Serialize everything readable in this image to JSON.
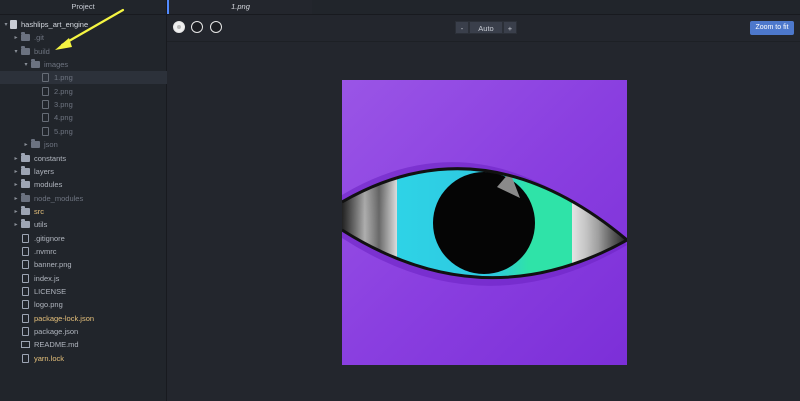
{
  "sidebar": {
    "header": "Project",
    "tree": [
      {
        "label": "hashlips_art_engine",
        "type": "repo",
        "depth": 0,
        "chevron": "down",
        "style": "root"
      },
      {
        "label": ".git",
        "type": "folder",
        "depth": 1,
        "chevron": "right",
        "style": "dim"
      },
      {
        "label": "build",
        "type": "folder",
        "depth": 1,
        "chevron": "down",
        "style": "dim"
      },
      {
        "label": "images",
        "type": "folder",
        "depth": 2,
        "chevron": "down",
        "style": "dim"
      },
      {
        "label": "1.png",
        "type": "file",
        "depth": 3,
        "style": "dim",
        "selected": true
      },
      {
        "label": "2.png",
        "type": "file",
        "depth": 3,
        "style": "dim"
      },
      {
        "label": "3.png",
        "type": "file",
        "depth": 3,
        "style": "dim"
      },
      {
        "label": "4.png",
        "type": "file",
        "depth": 3,
        "style": "dim"
      },
      {
        "label": "5.png",
        "type": "file",
        "depth": 3,
        "style": "dim"
      },
      {
        "label": "json",
        "type": "folder",
        "depth": 2,
        "chevron": "right",
        "style": "dim"
      },
      {
        "label": "constants",
        "type": "folder",
        "depth": 1,
        "chevron": "right",
        "style": "normal"
      },
      {
        "label": "layers",
        "type": "folder",
        "depth": 1,
        "chevron": "right",
        "style": "normal"
      },
      {
        "label": "modules",
        "type": "folder",
        "depth": 1,
        "chevron": "right",
        "style": "normal"
      },
      {
        "label": "node_modules",
        "type": "folder",
        "depth": 1,
        "chevron": "right",
        "style": "dim"
      },
      {
        "label": "src",
        "type": "folder",
        "depth": 1,
        "chevron": "right",
        "style": "yellow"
      },
      {
        "label": "utils",
        "type": "folder",
        "depth": 1,
        "chevron": "right",
        "style": "normal"
      },
      {
        "label": ".gitignore",
        "type": "file",
        "depth": 1,
        "style": "normal"
      },
      {
        "label": ".nvmrc",
        "type": "file",
        "depth": 1,
        "style": "normal"
      },
      {
        "label": "banner.png",
        "type": "file",
        "depth": 1,
        "style": "normal"
      },
      {
        "label": "index.js",
        "type": "file",
        "depth": 1,
        "style": "normal"
      },
      {
        "label": "LICENSE",
        "type": "file",
        "depth": 1,
        "style": "normal"
      },
      {
        "label": "logo.png",
        "type": "file",
        "depth": 1,
        "style": "normal"
      },
      {
        "label": "package-lock.json",
        "type": "file",
        "depth": 1,
        "style": "yellow"
      },
      {
        "label": "package.json",
        "type": "file",
        "depth": 1,
        "style": "normal"
      },
      {
        "label": "README.md",
        "type": "md",
        "depth": 1,
        "style": "normal"
      },
      {
        "label": "yarn.lock",
        "type": "file",
        "depth": 1,
        "style": "yellow"
      }
    ]
  },
  "tab": {
    "title": "1.png"
  },
  "toolbar": {
    "zoom_minus": "-",
    "zoom_value": "Auto",
    "zoom_plus": "+",
    "fit_label": "Zoom to fit",
    "background_swatches": [
      "transparent-white-icon",
      "white-circle-icon",
      "black-circle-icon"
    ]
  },
  "colors": {
    "accent": "#4d78cc",
    "tab_indicator": "#528bff",
    "annotation_arrow": "#f5f542",
    "art_background": "#8a3fe0",
    "iris_cyan": "#2ed3e6",
    "iris_green": "#2fe3a8"
  }
}
